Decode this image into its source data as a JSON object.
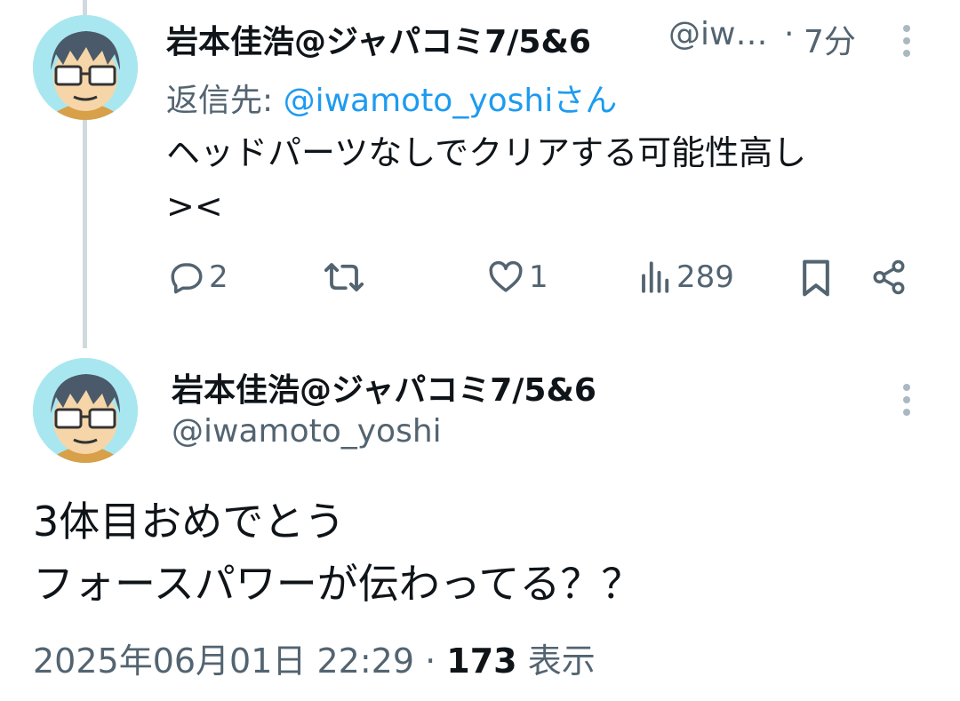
{
  "reply_tweet": {
    "author_name": "岩本佳浩@ジャパコミ7/5&6",
    "handle_truncated": "@iw…",
    "separator": "·",
    "time_ago": "7分",
    "replying_to_label": "返信先:",
    "replying_to_handle": "@iwamoto_yoshi",
    "replying_to_suffix": "さん",
    "text_line1": "ヘッドパーツなしでクリアする可能性高し",
    "text_line2": "><",
    "actions": {
      "reply_count": "2",
      "like_count": "1",
      "view_count": "289"
    }
  },
  "main_tweet": {
    "author_name": "岩本佳浩@ジャパコミ7/5&6",
    "handle": "@iwamoto_yoshi",
    "text_line1": "3体目おめでとう",
    "text_line2": "フォースパワーが伝わってる？？",
    "timestamp": "2025年06月01日 22:29",
    "separator": "·",
    "view_count": "173",
    "view_label": "表示"
  },
  "colors": {
    "accent": "#1d9bf0",
    "muted": "#536471",
    "thread_line": "#cfd9de"
  }
}
